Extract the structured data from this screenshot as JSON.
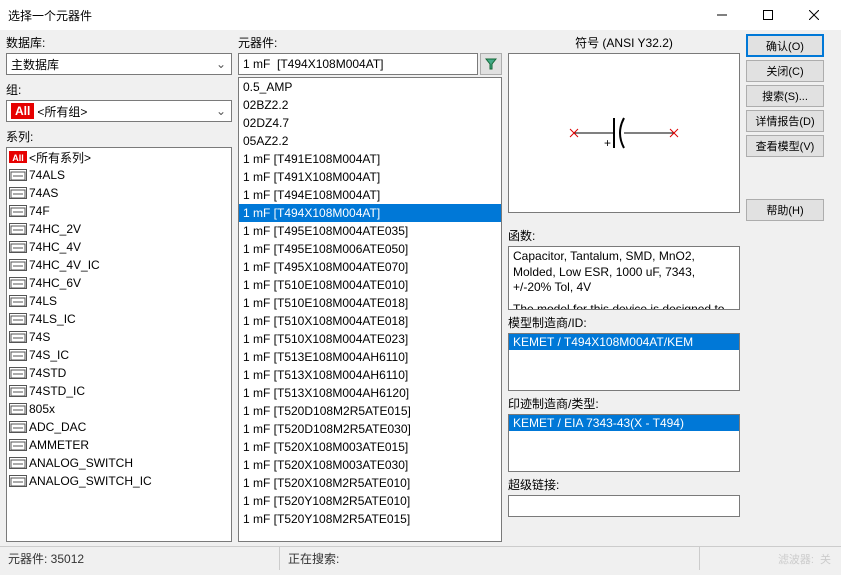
{
  "window": {
    "title": "选择一个元器件"
  },
  "left": {
    "db_label": "数据库:",
    "db_value": "主数据库",
    "group_label": "组:",
    "group_value": "<所有组>",
    "series_label": "系列:",
    "series": [
      {
        "icon": "all",
        "label": "<所有系列>"
      },
      {
        "icon": "c",
        "label": "74ALS"
      },
      {
        "icon": "c",
        "label": "74AS"
      },
      {
        "icon": "c",
        "label": "74F"
      },
      {
        "icon": "c",
        "label": "74HC_2V"
      },
      {
        "icon": "c",
        "label": "74HC_4V"
      },
      {
        "icon": "c",
        "label": "74HC_4V_IC"
      },
      {
        "icon": "c",
        "label": "74HC_6V"
      },
      {
        "icon": "c",
        "label": "74LS"
      },
      {
        "icon": "c",
        "label": "74LS_IC"
      },
      {
        "icon": "c",
        "label": "74S"
      },
      {
        "icon": "c",
        "label": "74S_IC"
      },
      {
        "icon": "c",
        "label": "74STD"
      },
      {
        "icon": "c",
        "label": "74STD_IC"
      },
      {
        "icon": "b",
        "label": "805x"
      },
      {
        "icon": "g",
        "label": "ADC_DAC"
      },
      {
        "icon": "a",
        "label": "AMMETER"
      },
      {
        "icon": "s",
        "label": "ANALOG_SWITCH"
      },
      {
        "icon": "s",
        "label": "ANALOG_SWITCH_IC"
      }
    ]
  },
  "mid": {
    "comp_label": "元器件:",
    "comp_input": "1 mF  [T494X108M004AT]",
    "selected_index": 7,
    "items": [
      "0.5_AMP",
      "02BZ2.2",
      "02DZ4.7",
      "05AZ2.2",
      "1 mF  [T491E108M004AT]",
      "1 mF  [T491X108M004AT]",
      "1 mF  [T494E108M004AT]",
      "1 mF  [T494X108M004AT]",
      "1 mF  [T495E108M004ATE035]",
      "1 mF  [T495E108M006ATE050]",
      "1 mF  [T495X108M004ATE070]",
      "1 mF  [T510E108M004ATE010]",
      "1 mF  [T510E108M004ATE018]",
      "1 mF  [T510X108M004ATE018]",
      "1 mF  [T510X108M004ATE023]",
      "1 mF  [T513E108M004AH6110]",
      "1 mF  [T513X108M004AH6110]",
      "1 mF  [T513X108M004AH6120]",
      "1 mF  [T520D108M2R5ATE015]",
      "1 mF  [T520D108M2R5ATE030]",
      "1 mF  [T520X108M003ATE015]",
      "1 mF  [T520X108M003ATE030]",
      "1 mF  [T520X108M2R5ATE010]",
      "1 mF  [T520Y108M2R5ATE010]",
      "1 mF  [T520Y108M2R5ATE015]"
    ]
  },
  "sym": {
    "header": "符号 (ANSI Y32.2)",
    "func_label": "函数:",
    "func_text_1": "Capacitor, Tantalum, SMD, MnO2, Molded, Low ESR, 1000 uF, 7343, +/-20% Tol, 4V",
    "func_text_2": "The model for this device is designed to be most accurate at the following conditions:",
    "mfr_label": "模型制造商/ID:",
    "mfr_value": "KEMET / T494X108M004AT/KEM",
    "fp_label": "印迹制造商/类型:",
    "fp_value": "KEMET / EIA 7343-43(X - T494)",
    "link_label": "超级链接:"
  },
  "buttons": {
    "ok": "确认(O)",
    "close": "关闭(C)",
    "search": "搜索(S)...",
    "detail": "详情报告(D)",
    "model": "查看模型(V)",
    "help": "帮助(H)"
  },
  "status": {
    "count_label": "元器件: 35012",
    "searching": "正在搜索:",
    "watermark1": "滤波器:",
    "watermark2": "关"
  }
}
